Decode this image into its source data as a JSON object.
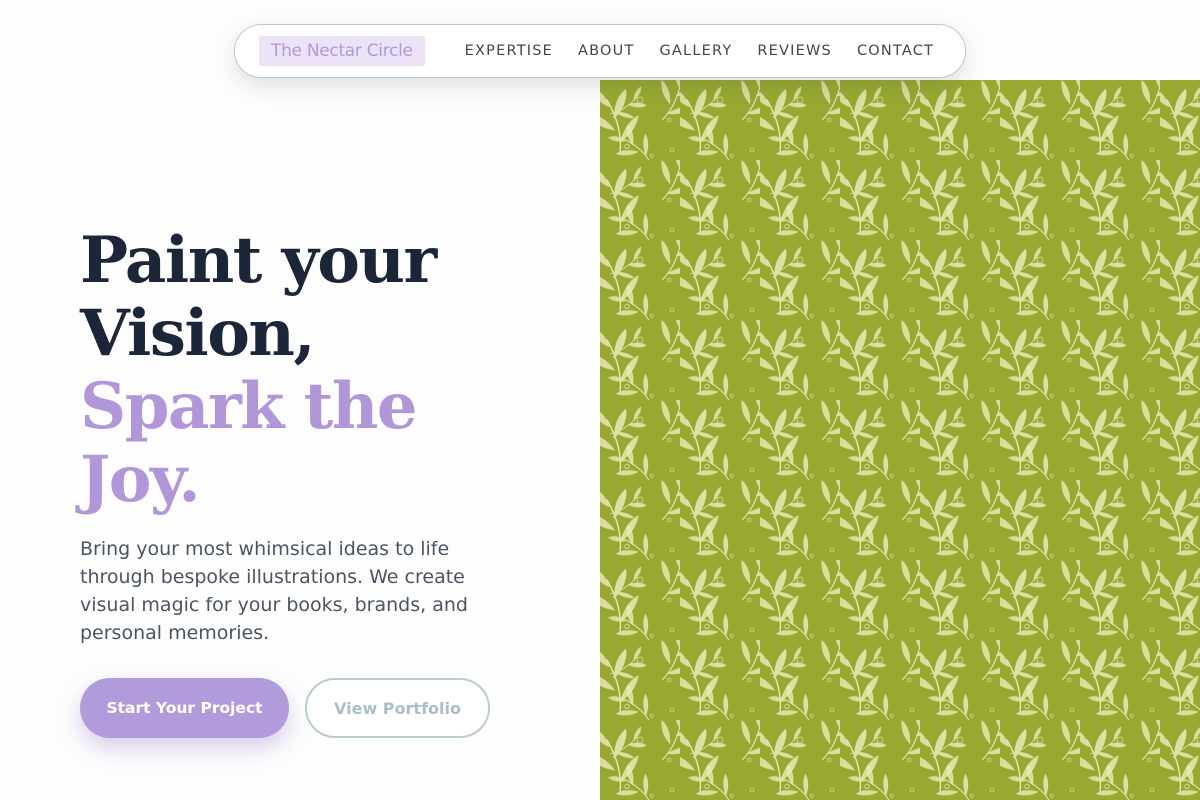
{
  "nav": {
    "brand": "The Nectar Circle",
    "links": [
      "EXPERTISE",
      "ABOUT",
      "GALLERY",
      "REVIEWS",
      "CONTACT"
    ]
  },
  "hero": {
    "title_line1": "Paint your",
    "title_line2": "Vision,",
    "title_line3": "Spark the",
    "title_line4": "Joy.",
    "description": "Bring your most whimsical ideas to life through bespoke illustrations. We create visual magic for your books, brands, and personal memories.",
    "primary_button": "Start Your Project",
    "secondary_button": "View Portfolio",
    "image_alt": "fern-pattern-illustration"
  },
  "colors": {
    "accent": "#b197d8",
    "heading": "#1b2738",
    "pattern_bg": "#9aaa32",
    "pattern_leaf": "#f3f2c6"
  }
}
